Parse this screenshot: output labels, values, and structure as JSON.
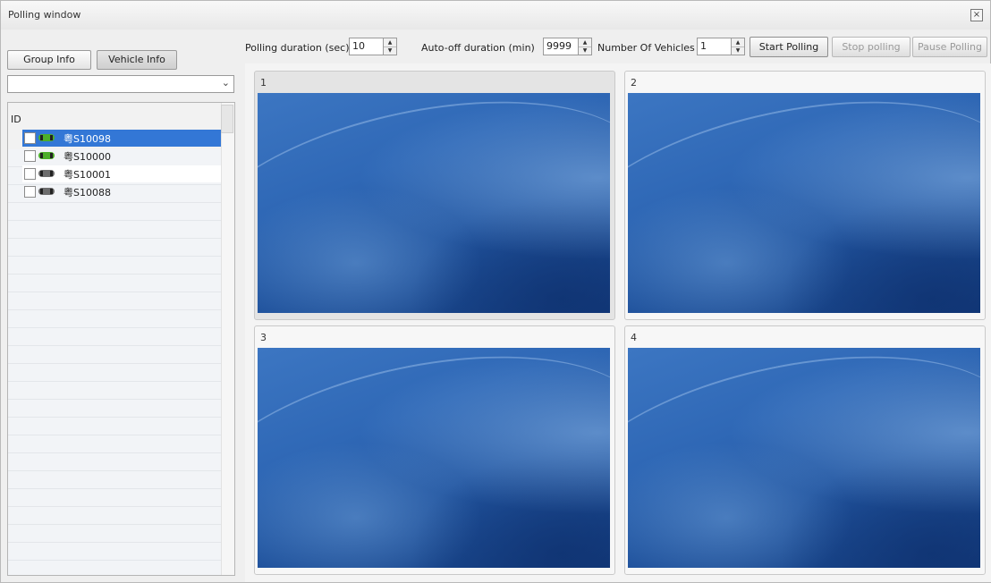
{
  "window": {
    "title": "Polling window",
    "close_glyph": "×"
  },
  "left_panel": {
    "tabs": [
      {
        "label": "Group Info",
        "active": false
      },
      {
        "label": "Vehicle Info",
        "active": true
      }
    ],
    "selector": {
      "value": "",
      "arrow": "⌄"
    },
    "tree": {
      "header": "ID",
      "rows": [
        {
          "plate": "粤S10098",
          "status": "online",
          "icon": "green-car-icon",
          "selected": true
        },
        {
          "plate": "粤S10000",
          "status": "online",
          "icon": "green-car-icon",
          "selected": false
        },
        {
          "plate": "粤S10001",
          "status": "offline",
          "icon": "gray-car-icon",
          "selected": false
        },
        {
          "plate": "粤S10088",
          "status": "offline",
          "icon": "gray-car-icon",
          "selected": false
        }
      ]
    }
  },
  "toolbar": {
    "polling_duration_label": "Polling duration (sec)",
    "polling_duration_value": "10",
    "auto_off_label": "Auto-off duration (min)",
    "auto_off_value": "9999",
    "num_vehicles_label": "Number Of Vehicles",
    "num_vehicles_value": "1",
    "start_label": "Start Polling",
    "stop_label": "Stop polling",
    "pause_label": "Pause Polling",
    "spin_up_glyph": "▲",
    "spin_down_glyph": "▼"
  },
  "video_panels": [
    {
      "number": "1"
    },
    {
      "number": "2"
    },
    {
      "number": "3"
    },
    {
      "number": "4"
    }
  ],
  "colors": {
    "selection": "#3377d6",
    "online_car": "#4cae2a",
    "offline_car": "#6d6d6d"
  }
}
